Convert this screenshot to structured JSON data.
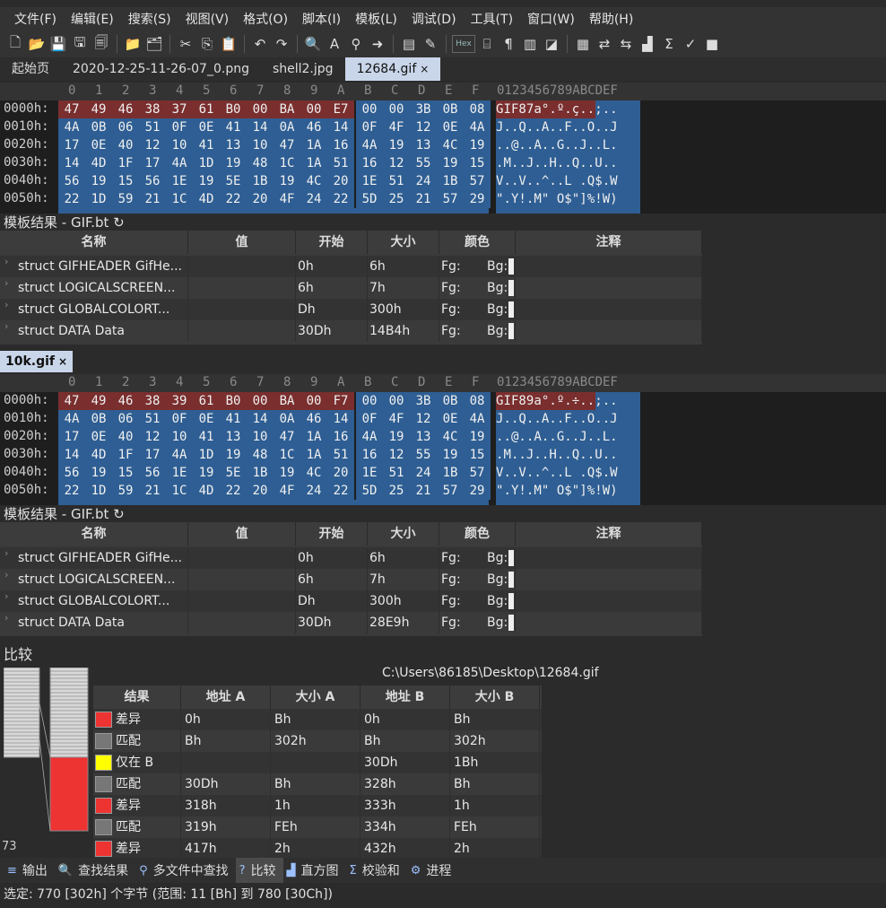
{
  "menu": [
    "文件(F)",
    "编辑(E)",
    "搜索(S)",
    "视图(V)",
    "格式(O)",
    "脚本(I)",
    "模板(L)",
    "调试(D)",
    "工具(T)",
    "窗口(W)",
    "帮助(H)"
  ],
  "toolbar": {
    "icons": [
      "new-file-icon",
      "open-folder-icon",
      "save-icon",
      "save-as-icon",
      "save-all-icon",
      "folder-icon",
      "open-multiple-icon",
      "cut-icon",
      "copy-icon",
      "paste-icon",
      "undo-icon",
      "redo-icon",
      "find-icon",
      "find-replace-icon",
      "find-in-files-icon",
      "goto-icon",
      "template-icon",
      "script-icon",
      "hex-icon",
      "ascii-icon",
      "pilcrow-icon",
      "columns-icon",
      "highlight-icon",
      "calculator-icon",
      "base-converter-icon",
      "swap-icon",
      "histogram-icon",
      "checksum-icon",
      "compare-icon",
      "stop-icon"
    ],
    "hex_label": "Hex",
    "pilcrow": "¶"
  },
  "tabs": [
    {
      "label": "起始页",
      "active": false
    },
    {
      "label": "2020-12-25-11-26-07_0.png",
      "active": false
    },
    {
      "label": "shell2.jpg",
      "active": false
    },
    {
      "label": "12684.gif",
      "active": true,
      "close": "×"
    }
  ],
  "hex_header": {
    "cols": [
      "0",
      "1",
      "2",
      "3",
      "4",
      "5",
      "6",
      "7",
      "8",
      "9",
      "A",
      "B",
      "C",
      "D",
      "E",
      "F"
    ],
    "ascii": "0123456789ABCDEF"
  },
  "file1": {
    "rows": [
      {
        "addr": "0000h:",
        "bytes": [
          "47",
          "49",
          "46",
          "38",
          "37",
          "61",
          "B0",
          "00",
          "BA",
          "00",
          "E7",
          "00",
          "00",
          "3B",
          "0B",
          "08"
        ],
        "ascii": "GIF87a°.º.ç..;.."
      },
      {
        "addr": "0010h:",
        "bytes": [
          "4A",
          "0B",
          "06",
          "51",
          "0F",
          "0E",
          "41",
          "14",
          "0A",
          "46",
          "14",
          "0F",
          "4F",
          "12",
          "0E",
          "4A"
        ],
        "ascii": "J..Q..A..F..O..J"
      },
      {
        "addr": "0020h:",
        "bytes": [
          "17",
          "0E",
          "40",
          "12",
          "10",
          "41",
          "13",
          "10",
          "47",
          "1A",
          "16",
          "4A",
          "19",
          "13",
          "4C",
          "19"
        ],
        "ascii": "..@..A..G..J..L."
      },
      {
        "addr": "0030h:",
        "bytes": [
          "14",
          "4D",
          "1F",
          "17",
          "4A",
          "1D",
          "19",
          "48",
          "1C",
          "1A",
          "51",
          "16",
          "12",
          "55",
          "19",
          "15"
        ],
        "ascii": ".M..J..H..Q..U.."
      },
      {
        "addr": "0040h:",
        "bytes": [
          "56",
          "19",
          "15",
          "56",
          "1E",
          "19",
          "5E",
          "1B",
          "19",
          "4C",
          "20",
          "1E",
          "51",
          "24",
          "1B",
          "57"
        ],
        "ascii": "V..V..^..L .Q$.W"
      },
      {
        "addr": "0050h:",
        "bytes": [
          "22",
          "1D",
          "59",
          "21",
          "1C",
          "4D",
          "22",
          "20",
          "4F",
          "24",
          "22",
          "5D",
          "25",
          "21",
          "57",
          "29"
        ],
        "ascii": "\".Y!.M\" O$\"]%!W)"
      }
    ],
    "template_label": "模板结果 - GIF.bt ↻",
    "struct_rows": [
      {
        "name": "struct GIFHEADER GifHe...",
        "start": "0h",
        "size": "6h",
        "fg": "Fg:",
        "bg": "Bg:"
      },
      {
        "name": "struct LOGICALSCREEN...",
        "start": "6h",
        "size": "7h",
        "fg": "Fg:",
        "bg": "Bg:"
      },
      {
        "name": "struct GLOBALCOLORT...",
        "start": "Dh",
        "size": "300h",
        "fg": "Fg:",
        "bg": "Bg:"
      },
      {
        "name": "struct DATA Data",
        "start": "30Dh",
        "size": "14B4h",
        "fg": "Fg:",
        "bg": "Bg:"
      }
    ]
  },
  "table_headers": {
    "name": "名称",
    "value": "值",
    "start": "开始",
    "size": "大小",
    "color": "颜色",
    "comment": "注释"
  },
  "tab2": {
    "label": "10k.gif",
    "close": "×"
  },
  "file2": {
    "rows": [
      {
        "addr": "0000h:",
        "bytes": [
          "47",
          "49",
          "46",
          "38",
          "39",
          "61",
          "B0",
          "00",
          "BA",
          "00",
          "F7",
          "00",
          "00",
          "3B",
          "0B",
          "08"
        ],
        "ascii": "GIF89a°.º.÷..;.."
      },
      {
        "addr": "0010h:",
        "bytes": [
          "4A",
          "0B",
          "06",
          "51",
          "0F",
          "0E",
          "41",
          "14",
          "0A",
          "46",
          "14",
          "0F",
          "4F",
          "12",
          "0E",
          "4A"
        ],
        "ascii": "J..Q..A..F..O..J"
      },
      {
        "addr": "0020h:",
        "bytes": [
          "17",
          "0E",
          "40",
          "12",
          "10",
          "41",
          "13",
          "10",
          "47",
          "1A",
          "16",
          "4A",
          "19",
          "13",
          "4C",
          "19"
        ],
        "ascii": "..@..A..G..J..L."
      },
      {
        "addr": "0030h:",
        "bytes": [
          "14",
          "4D",
          "1F",
          "17",
          "4A",
          "1D",
          "19",
          "48",
          "1C",
          "1A",
          "51",
          "16",
          "12",
          "55",
          "19",
          "15"
        ],
        "ascii": ".M..J..H..Q..U.."
      },
      {
        "addr": "0040h:",
        "bytes": [
          "56",
          "19",
          "15",
          "56",
          "1E",
          "19",
          "5E",
          "1B",
          "19",
          "4C",
          "20",
          "1E",
          "51",
          "24",
          "1B",
          "57"
        ],
        "ascii": "V..V..^..L .Q$.W"
      },
      {
        "addr": "0050h:",
        "bytes": [
          "22",
          "1D",
          "59",
          "21",
          "1C",
          "4D",
          "22",
          "20",
          "4F",
          "24",
          "22",
          "5D",
          "25",
          "21",
          "57",
          "29"
        ],
        "ascii": "\".Y!.M\" O$\"]%!W)"
      }
    ],
    "template_label": "模板结果 - GIF.bt ↻",
    "struct_rows": [
      {
        "name": "struct GIFHEADER GifHe...",
        "start": "0h",
        "size": "6h",
        "fg": "Fg:",
        "bg": "Bg:"
      },
      {
        "name": "struct LOGICALSCREEN...",
        "start": "6h",
        "size": "7h",
        "fg": "Fg:",
        "bg": "Bg:"
      },
      {
        "name": "struct GLOBALCOLORT...",
        "start": "Dh",
        "size": "300h",
        "fg": "Fg:",
        "bg": "Bg:"
      },
      {
        "name": "struct DATA Data",
        "start": "30Dh",
        "size": "28E9h",
        "fg": "Fg:",
        "bg": "Bg:"
      }
    ]
  },
  "compare": {
    "title": "比较",
    "path": "C:\\Users\\86185\\Desktop\\12684.gif",
    "headers": {
      "result": "结果",
      "addr_a": "地址 A",
      "size_a": "大小 A",
      "addr_b": "地址 B",
      "size_b": "大小 B"
    },
    "rows": [
      {
        "result": "差异",
        "color": "#ee3333",
        "addr_a": "0h",
        "size_a": "Bh",
        "addr_b": "0h",
        "size_b": "Bh"
      },
      {
        "result": "匹配",
        "color": "#777777",
        "addr_a": "Bh",
        "size_a": "302h",
        "addr_b": "Bh",
        "size_b": "302h"
      },
      {
        "result": "仅在 B",
        "color": "#ffff00",
        "addr_a": "",
        "size_a": "",
        "addr_b": "30Dh",
        "size_b": "1Bh"
      },
      {
        "result": "匹配",
        "color": "#777777",
        "addr_a": "30Dh",
        "size_a": "Bh",
        "addr_b": "328h",
        "size_b": "Bh"
      },
      {
        "result": "差异",
        "color": "#ee3333",
        "addr_a": "318h",
        "size_a": "1h",
        "addr_b": "333h",
        "size_b": "1h"
      },
      {
        "result": "匹配",
        "color": "#777777",
        "addr_a": "319h",
        "size_a": "FEh",
        "addr_b": "334h",
        "size_b": "FEh"
      },
      {
        "result": "差异",
        "color": "#ee3333",
        "addr_a": "417h",
        "size_a": "2h",
        "addr_b": "432h",
        "size_b": "2h"
      }
    ],
    "count": "73"
  },
  "bottom_tabs": [
    {
      "label": "输出",
      "icon": "output-icon",
      "active": false
    },
    {
      "label": "查找结果",
      "icon": "find-results-icon",
      "active": false
    },
    {
      "label": "多文件中查找",
      "icon": "find-in-files-icon",
      "active": false
    },
    {
      "label": "比较",
      "icon": "compare-icon",
      "active": true
    },
    {
      "label": "直方图",
      "icon": "histogram-icon",
      "active": false
    },
    {
      "label": "校验和",
      "icon": "checksum-icon",
      "active": false
    },
    {
      "label": "进程",
      "icon": "process-icon",
      "active": false
    }
  ],
  "status": "选定: 770 [302h] 个字节 (范围: 11 [Bh] 到 780 [30Ch])"
}
